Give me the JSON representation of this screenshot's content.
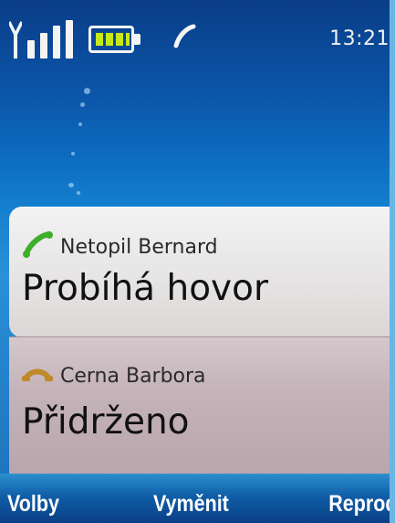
{
  "status_bar": {
    "signal_icon": "signal-strength-icon",
    "battery_icon": "battery-icon",
    "call_icon": "active-call-icon",
    "time": "13:21"
  },
  "calls": [
    {
      "icon": "phone-active-icon",
      "icon_color": "#3fae2a",
      "name": "Netopil Bernard",
      "state": "Probíhá hovor"
    },
    {
      "icon": "phone-hold-icon",
      "icon_color": "#c08a2a",
      "name": "Cerna Barbora",
      "state": "Přidrženo"
    }
  ],
  "softkeys": {
    "left": "Volby",
    "middle": "Vyměnit",
    "right": "Reprod."
  },
  "colors": {
    "accent": "#0d6cc0",
    "battery_fill": "#c7e81a"
  }
}
